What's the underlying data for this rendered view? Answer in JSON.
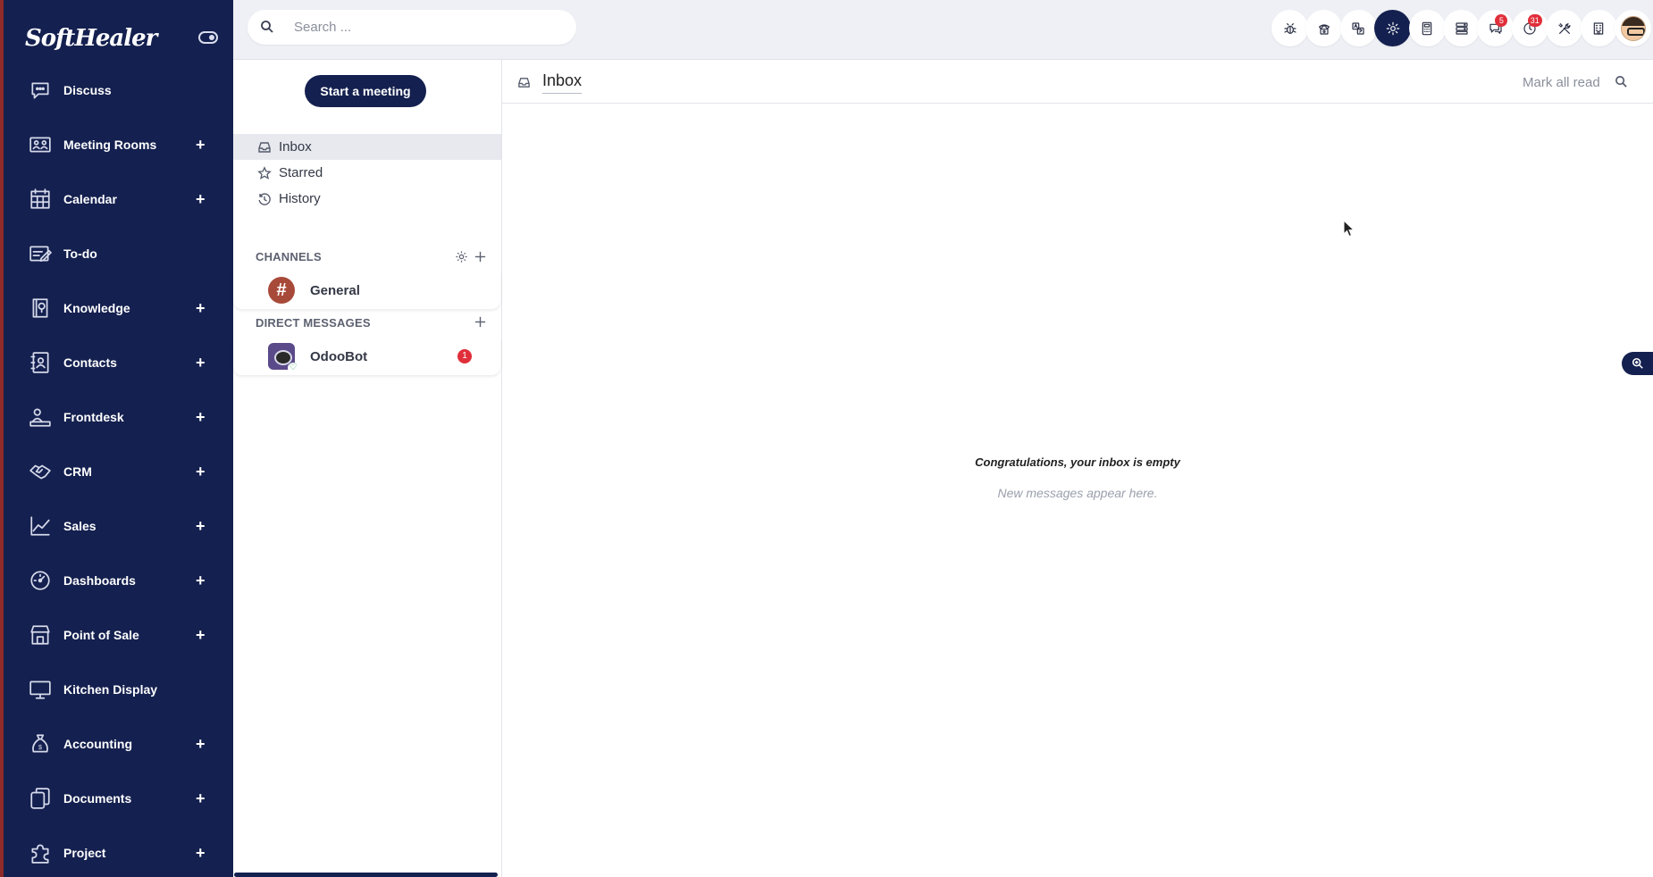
{
  "brand": {
    "name": "SoftHealer"
  },
  "sidebar": {
    "items": [
      {
        "label": "Discuss",
        "icon": "chat-bubble-icon",
        "expandable": false
      },
      {
        "label": "Meeting Rooms",
        "icon": "meeting-room-icon",
        "expandable": true
      },
      {
        "label": "Calendar",
        "icon": "calendar-icon",
        "expandable": true
      },
      {
        "label": "To-do",
        "icon": "todo-icon",
        "expandable": false
      },
      {
        "label": "Knowledge",
        "icon": "knowledge-book-icon",
        "expandable": true
      },
      {
        "label": "Contacts",
        "icon": "contacts-icon",
        "expandable": true
      },
      {
        "label": "Frontdesk",
        "icon": "frontdesk-icon",
        "expandable": true
      },
      {
        "label": "CRM",
        "icon": "handshake-icon",
        "expandable": true
      },
      {
        "label": "Sales",
        "icon": "sales-chart-icon",
        "expandable": true
      },
      {
        "label": "Dashboards",
        "icon": "dashboard-gauge-icon",
        "expandable": true
      },
      {
        "label": "Point of Sale",
        "icon": "store-icon",
        "expandable": true
      },
      {
        "label": "Kitchen Display",
        "icon": "monitor-icon",
        "expandable": false
      },
      {
        "label": "Accounting",
        "icon": "money-bag-icon",
        "expandable": true
      },
      {
        "label": "Documents",
        "icon": "documents-icon",
        "expandable": true
      },
      {
        "label": "Project",
        "icon": "puzzle-icon",
        "expandable": true
      }
    ],
    "plus_symbol": "+"
  },
  "topbar": {
    "search_placeholder": "Search ...",
    "icons": [
      {
        "name": "bug-icon",
        "active": false,
        "badge": ""
      },
      {
        "name": "phone-icon",
        "active": false,
        "badge": ""
      },
      {
        "name": "translate-icon",
        "active": false,
        "badge": ""
      },
      {
        "name": "gear-icon",
        "active": true,
        "badge": ""
      },
      {
        "name": "calculator-icon",
        "active": false,
        "badge": ""
      },
      {
        "name": "server-icon",
        "active": false,
        "badge": ""
      },
      {
        "name": "messages-icon",
        "active": false,
        "badge": "5"
      },
      {
        "name": "activity-clock-icon",
        "active": false,
        "badge": "31"
      },
      {
        "name": "tools-icon",
        "active": false,
        "badge": ""
      },
      {
        "name": "company-building-icon",
        "active": false,
        "badge": ""
      }
    ]
  },
  "panel": {
    "start_meeting": "Start a meeting",
    "mailboxes": [
      {
        "label": "Inbox",
        "icon": "inbox-icon",
        "active": true
      },
      {
        "label": "Starred",
        "icon": "star-icon",
        "active": false
      },
      {
        "label": "History",
        "icon": "history-icon",
        "active": false
      }
    ],
    "channels_header": "CHANNELS",
    "channels": [
      {
        "name": "General",
        "avatar": "#"
      }
    ],
    "dm_header": "DIRECT MESSAGES",
    "direct_messages": [
      {
        "name": "OdooBot",
        "unread": "1"
      }
    ]
  },
  "main": {
    "title": "Inbox",
    "mark_all_read": "Mark all read",
    "empty_title": "Congratulations, your inbox is empty",
    "empty_subtitle": "New messages appear here."
  },
  "colors": {
    "sidebar_bg": "#14204f",
    "accent": "#14204f",
    "badge": "#e02f3a",
    "topbar_bg": "#eef0f5"
  }
}
